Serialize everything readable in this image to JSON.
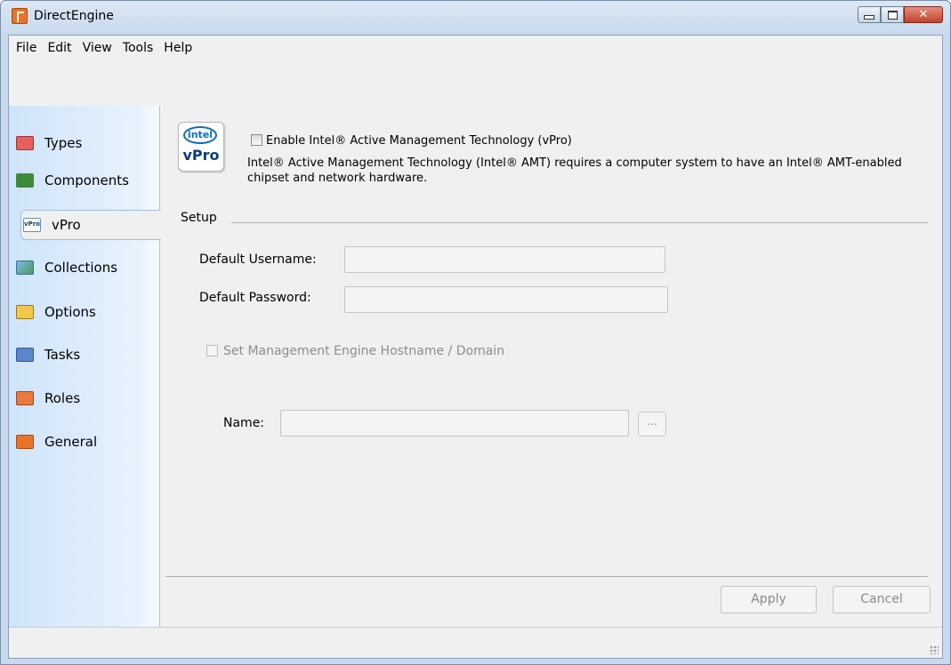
{
  "window": {
    "title": "DirectEngine",
    "close_glyph": "✕",
    "app_icon": "directengine-icon"
  },
  "menubar": {
    "items": [
      "File",
      "Edit",
      "View",
      "Tools",
      "Help"
    ]
  },
  "sidebar": {
    "items": [
      {
        "label": "Types",
        "icon": "types-icon"
      },
      {
        "label": "Components",
        "icon": "components-icon"
      },
      {
        "label": "vPro",
        "icon": "vpro-icon",
        "active": true
      },
      {
        "label": "Collections",
        "icon": "collections-icon"
      },
      {
        "label": "Options",
        "icon": "options-icon"
      },
      {
        "label": "Tasks",
        "icon": "tasks-icon"
      },
      {
        "label": "Roles",
        "icon": "roles-icon"
      },
      {
        "label": "General",
        "icon": "general-icon"
      }
    ]
  },
  "vpro_panel": {
    "logo": {
      "brand": "intel",
      "product": "vPro"
    },
    "enable_checkbox": {
      "label": "Enable Intel® Active Management Technology (vPro)",
      "checked": false
    },
    "description": "Intel® Active Management Technology (Intel® AMT) requires a computer system to have an Intel® AMT-enabled chipset and network hardware.",
    "setup": {
      "legend": "Setup",
      "username_label": "Default Username:",
      "username_value": "",
      "password_label": "Default Password:",
      "password_value": "",
      "hostname_checkbox": {
        "label": "Set Management Engine Hostname / Domain",
        "checked": false,
        "enabled": false
      },
      "name_label": "Name:",
      "name_value": "",
      "browse_label": "..."
    }
  },
  "buttons": {
    "apply": "Apply",
    "cancel": "Cancel"
  },
  "colors": {
    "sidebar_gradient_start": "#cfe4fa",
    "intel_blue": "#0a6fc2",
    "close_red": "#c4422c"
  }
}
